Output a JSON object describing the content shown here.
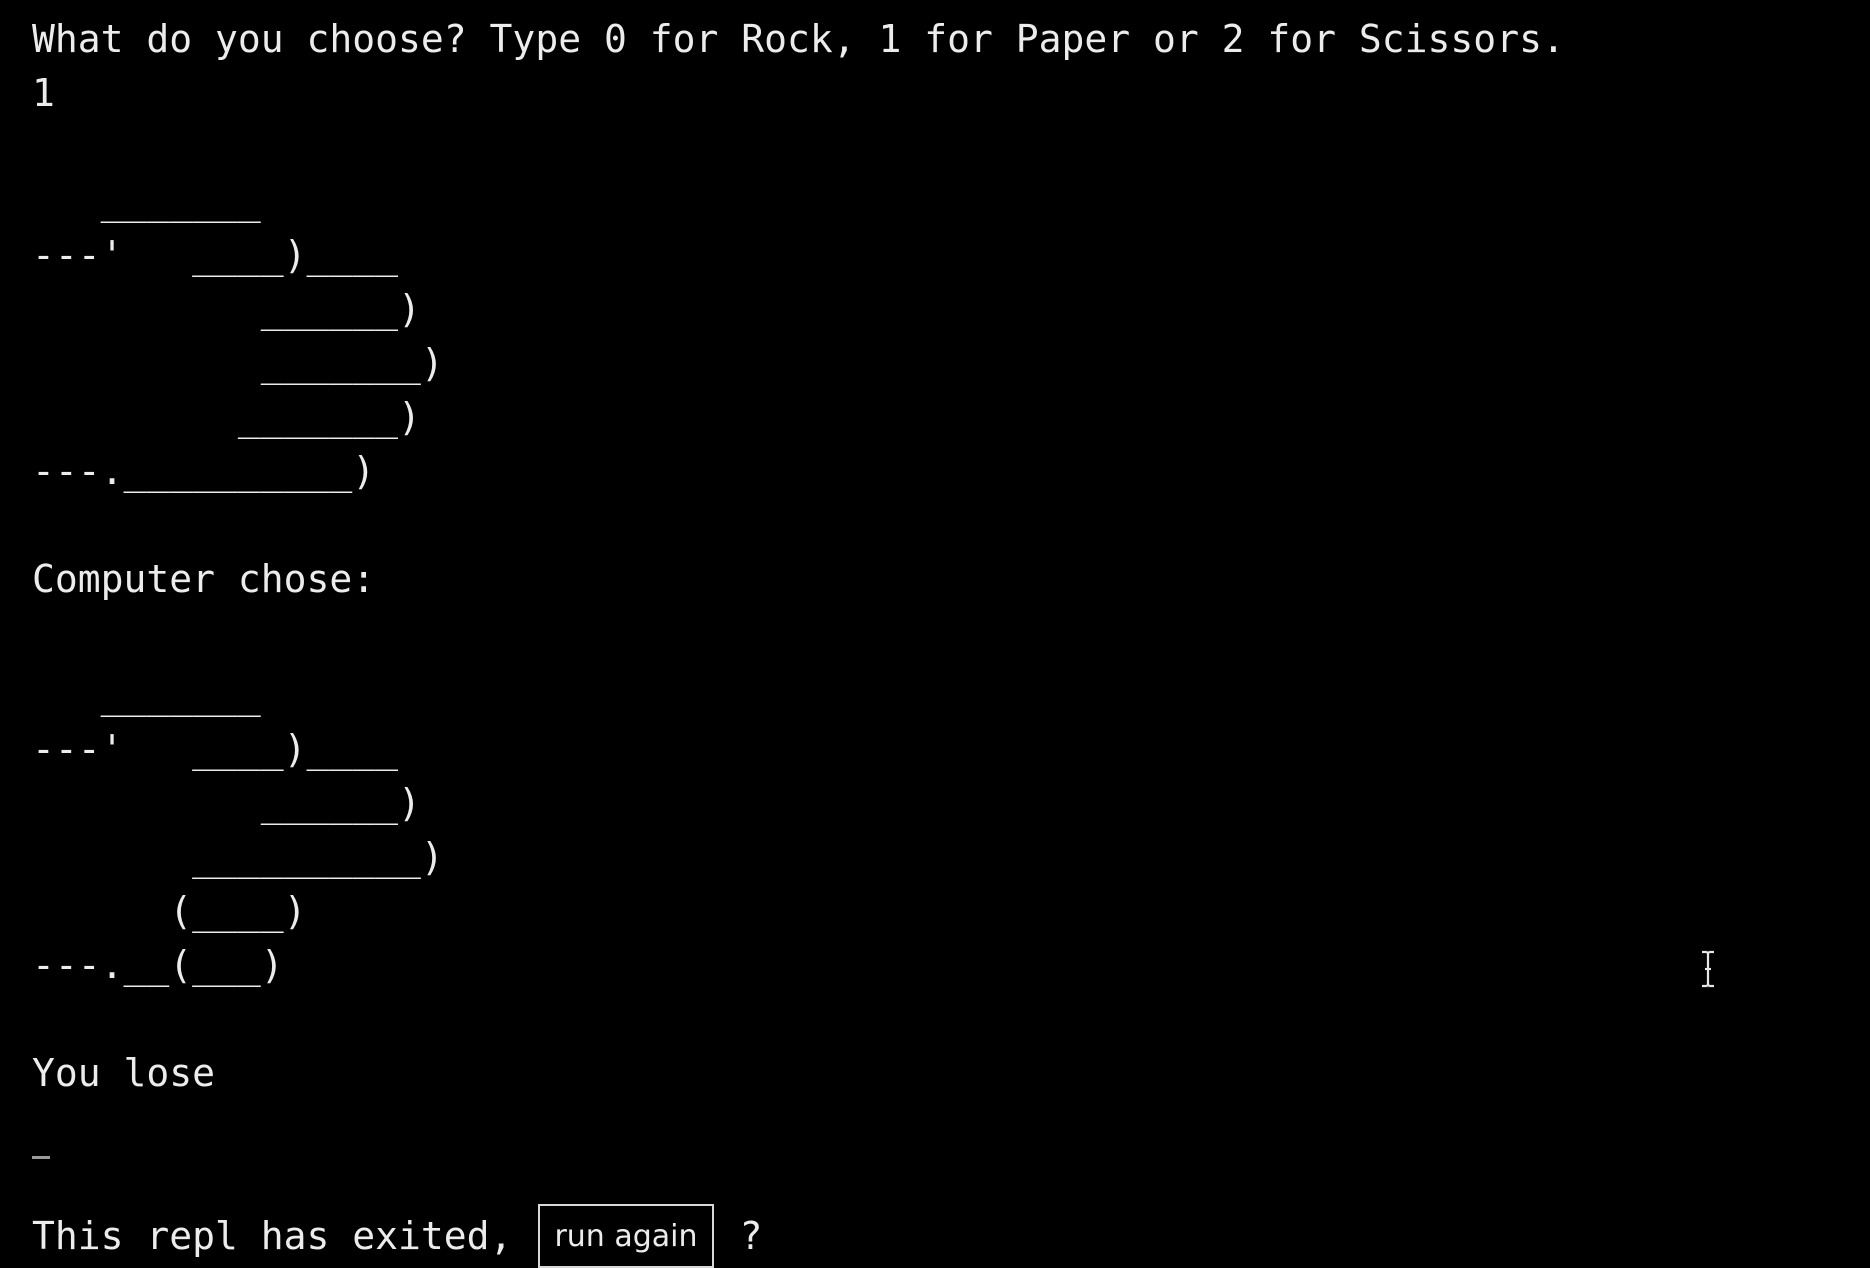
{
  "terminal": {
    "prompt": "What do you choose? Type 0 for Rock, 1 for Paper or 2 for Scissors.",
    "user_input": "1",
    "player_art": "   _______\n---'   ____)____\n          ______)\n          _______)\n         _______)\n---.__________)",
    "computer_label": "Computer chose:",
    "computer_art": "   _______\n---'   ____)____\n          ______)\n       __________)\n      (____)\n---.__(___)",
    "result": "You lose",
    "exit_message": "This repl has exited,",
    "run_again_label": "run again",
    "exit_suffix": "?"
  },
  "icons": {
    "mouse_cursor": "text-cursor-icon",
    "input_caret": "caret-icon"
  }
}
